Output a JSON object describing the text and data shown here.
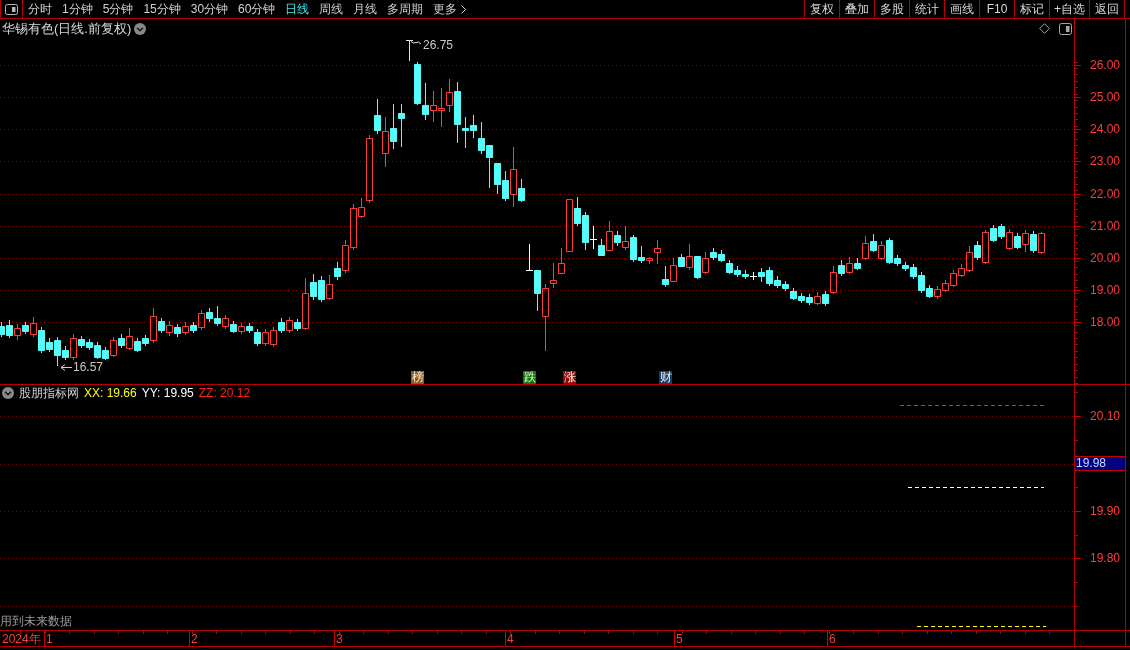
{
  "toolbar": {
    "periods": [
      {
        "label": "分时",
        "selected": false
      },
      {
        "label": "1分钟",
        "selected": false
      },
      {
        "label": "5分钟",
        "selected": false
      },
      {
        "label": "15分钟",
        "selected": false
      },
      {
        "label": "30分钟",
        "selected": false
      },
      {
        "label": "60分钟",
        "selected": false
      },
      {
        "label": "日线",
        "selected": true
      },
      {
        "label": "周线",
        "selected": false
      },
      {
        "label": "月线",
        "selected": false
      },
      {
        "label": "多周期",
        "selected": false
      }
    ],
    "more": "更多",
    "actions": [
      "复权",
      "叠加",
      "多股",
      "统计",
      "画线",
      "F10",
      "标记",
      "+自选",
      "返回"
    ]
  },
  "chart": {
    "title": "华锡有色(日线.前复权)",
    "high_marker": "26.75",
    "low_marker": "16.57",
    "signals": [
      {
        "label": "榜",
        "color": "#8b5a1e"
      },
      {
        "label": "跌",
        "color": "#0b7a0b"
      },
      {
        "label": "涨",
        "color": "#8b0a0a"
      },
      {
        "label": "财",
        "color": "#153f6e"
      }
    ],
    "price_ticks": [
      "26.00",
      "25.00",
      "24.00",
      "23.00",
      "22.00",
      "21.00",
      "20.00",
      "19.00",
      "18.00"
    ]
  },
  "indicator": {
    "name": "股朋指标网",
    "lines": [
      {
        "label": "XX: 19.66",
        "color": "#ffff00"
      },
      {
        "label": "YY: 19.95",
        "color": "#ffffff"
      },
      {
        "label": "ZZ: 20.12",
        "color": "#ff2020"
      }
    ],
    "ticks": [
      "20.10",
      "19.90",
      "19.80"
    ],
    "current_value": "19.98",
    "note": "用到未来数据"
  },
  "time_axis": {
    "year": "2024年",
    "months": [
      "1",
      "2",
      "3",
      "4",
      "5",
      "6"
    ]
  }
}
